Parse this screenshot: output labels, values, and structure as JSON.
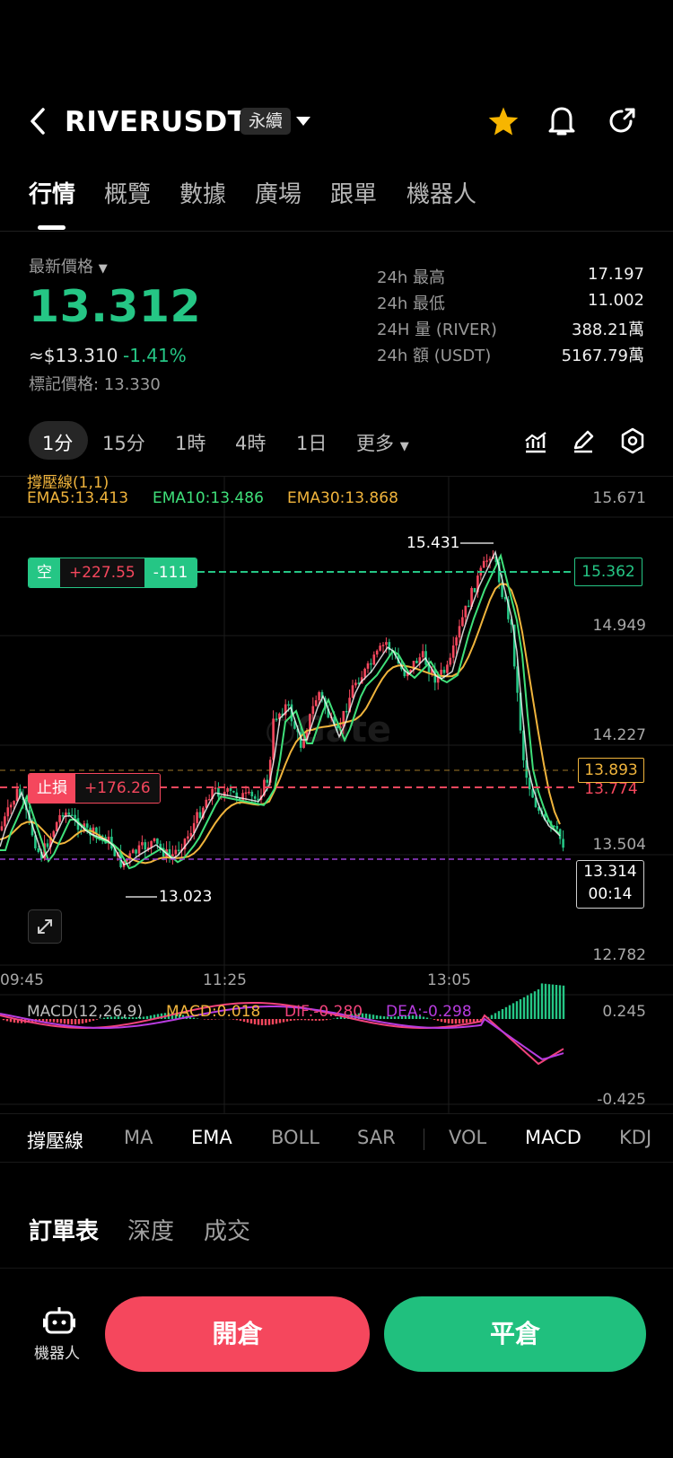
{
  "header": {
    "title": "RIVERUSDT",
    "badge": "永續",
    "tabs": [
      "行情",
      "概覽",
      "數據",
      "廣場",
      "跟單",
      "機器人"
    ]
  },
  "price": {
    "label": "最新價格",
    "last": "13.312",
    "fiat": "≈$13.310",
    "change_pct": "-1.41%",
    "mark": "標記價格: 13.330",
    "stats": [
      {
        "key": "24h  最高",
        "value": "17.197"
      },
      {
        "key": "24h  最低",
        "value": "11.002"
      },
      {
        "key": "24H  量 (RIVER)",
        "value": "388.21萬"
      },
      {
        "key": "24h  額 (USDT)",
        "value": "5167.79萬"
      }
    ]
  },
  "intervals": [
    "1分",
    "15分",
    "1時",
    "4時",
    "1日",
    "更多"
  ],
  "chart": {
    "sr_label": "撐壓線(1,1)",
    "ema5": "EMA5:13.413",
    "ema10": "EMA10:13.486",
    "ema30": "EMA30:13.868",
    "position": {
      "side": "空",
      "pnl": "+227.55",
      "qty": "-111",
      "price": "15.362"
    },
    "stop": {
      "label": "止損",
      "pnl": "+176.26",
      "price": "13.774"
    },
    "tag_ema30": "13.893",
    "current": {
      "price": "13.314",
      "countdown": "00:14"
    },
    "high_mark": "15.431",
    "low_mark": "13.023",
    "y_labels": [
      "15.671",
      "14.949",
      "14.227",
      "13.504",
      "12.782"
    ],
    "x_labels": [
      "09:45",
      "11:25",
      "13:05"
    ],
    "macd_params": "MACD(12,26,9)",
    "macd_val": "MACD:0.018",
    "dif": "DIF:-0.280",
    "dea": "DEA:-0.298",
    "macd_y_labels": [
      "0.245",
      "-0.425"
    ],
    "colors": {
      "up": "#f5475d",
      "down": "#25c685",
      "ema5": "#ffffff",
      "ema10": "#3fe07a",
      "ema30": "#f0b43c"
    }
  },
  "indicator_tabs": [
    "撐壓線",
    "MA",
    "EMA",
    "BOLL",
    "SAR",
    "VOL",
    "MACD",
    "KDJ"
  ],
  "order_tabs": [
    "訂單表",
    "深度",
    "成交"
  ],
  "bottom": {
    "robot_label": "機器人",
    "open": "開倉",
    "close": "平倉"
  }
}
